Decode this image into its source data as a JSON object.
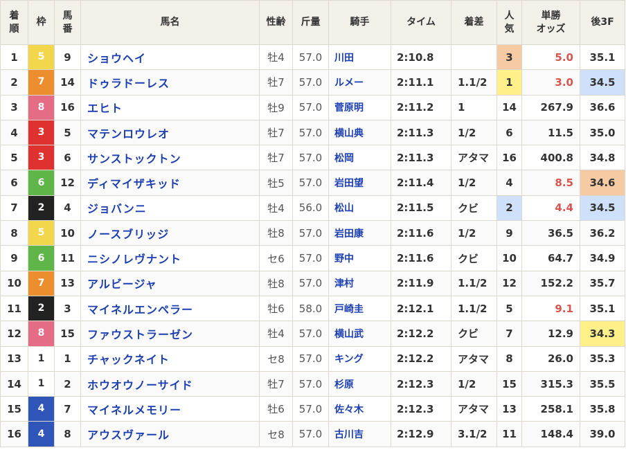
{
  "headers": {
    "pos": "着順",
    "gate": "枠",
    "num": "馬番",
    "name": "馬名",
    "sexage": "性齢",
    "weight": "斤量",
    "jockey": "騎手",
    "time": "タイム",
    "margin": "着差",
    "pop": "人気",
    "odds": "単勝オッズ",
    "last3f": "後3F"
  },
  "header_lines": {
    "pos": [
      "着",
      "順"
    ],
    "num": [
      "馬",
      "番"
    ],
    "pop": [
      "人",
      "気"
    ],
    "odds": [
      "単勝",
      "オッズ"
    ]
  },
  "gate_colors": {
    "1": {
      "bg": "#ffffff",
      "fg": "#333333"
    },
    "2": {
      "bg": "#222222",
      "fg": "#ffffff"
    },
    "3": {
      "bg": "#e03131",
      "fg": "#ffffff"
    },
    "4": {
      "bg": "#2f55b8",
      "fg": "#ffffff"
    },
    "5": {
      "bg": "#f2d64b",
      "fg": "#ffffff"
    },
    "6": {
      "bg": "#5fb547",
      "fg": "#ffffff"
    },
    "7": {
      "bg": "#ec8e2e",
      "fg": "#ffffff"
    },
    "8": {
      "bg": "#e46c84",
      "fg": "#ffffff"
    }
  },
  "rows": [
    {
      "pos": "1",
      "gate": "5",
      "num": "9",
      "name": "ショウヘイ",
      "sexage": "牡4",
      "weight": "57.0",
      "jockey": "川田",
      "time": "2:10.8",
      "margin": "",
      "pop": "3",
      "odds": "5.0",
      "last3f": "35.1",
      "fav": true,
      "pop_hl": "orange",
      "l3f_hl": ""
    },
    {
      "pos": "2",
      "gate": "7",
      "num": "14",
      "name": "ドゥラドーレス",
      "sexage": "牡7",
      "weight": "57.0",
      "jockey": "ルメー",
      "time": "2:11.1",
      "margin": "1.1/2",
      "pop": "1",
      "odds": "3.0",
      "last3f": "34.5",
      "fav": true,
      "pop_hl": "yellow",
      "l3f_hl": "blue"
    },
    {
      "pos": "3",
      "gate": "8",
      "num": "16",
      "name": "エヒト",
      "sexage": "牡9",
      "weight": "57.0",
      "jockey": "菅原明",
      "time": "2:11.2",
      "margin": "1",
      "pop": "14",
      "odds": "267.9",
      "last3f": "36.6",
      "fav": false,
      "pop_hl": "",
      "l3f_hl": ""
    },
    {
      "pos": "4",
      "gate": "3",
      "num": "5",
      "name": "マテンロウレオ",
      "sexage": "牡7",
      "weight": "57.0",
      "jockey": "横山典",
      "time": "2:11.3",
      "margin": "1/2",
      "pop": "6",
      "odds": "11.5",
      "last3f": "35.0",
      "fav": false,
      "pop_hl": "",
      "l3f_hl": ""
    },
    {
      "pos": "5",
      "gate": "3",
      "num": "6",
      "name": "サンストックトン",
      "sexage": "牡7",
      "weight": "57.0",
      "jockey": "松岡",
      "time": "2:11.3",
      "margin": "アタマ",
      "pop": "16",
      "odds": "400.8",
      "last3f": "34.8",
      "fav": false,
      "pop_hl": "",
      "l3f_hl": ""
    },
    {
      "pos": "6",
      "gate": "6",
      "num": "12",
      "name": "ディマイザキッド",
      "sexage": "牡5",
      "weight": "57.0",
      "jockey": "岩田望",
      "time": "2:11.4",
      "margin": "1/2",
      "pop": "4",
      "odds": "8.5",
      "last3f": "34.6",
      "fav": true,
      "pop_hl": "",
      "l3f_hl": "orange"
    },
    {
      "pos": "7",
      "gate": "2",
      "num": "4",
      "name": "ジョバンニ",
      "sexage": "牡4",
      "weight": "56.0",
      "jockey": "松山",
      "time": "2:11.5",
      "margin": "クビ",
      "pop": "2",
      "odds": "4.4",
      "last3f": "34.5",
      "fav": true,
      "pop_hl": "blue",
      "l3f_hl": "blue"
    },
    {
      "pos": "8",
      "gate": "5",
      "num": "10",
      "name": "ノースブリッジ",
      "sexage": "牡8",
      "weight": "57.0",
      "jockey": "岩田康",
      "time": "2:11.6",
      "margin": "1/2",
      "pop": "9",
      "odds": "36.5",
      "last3f": "36.2",
      "fav": false,
      "pop_hl": "",
      "l3f_hl": ""
    },
    {
      "pos": "9",
      "gate": "6",
      "num": "11",
      "name": "ニシノレヴナント",
      "sexage": "セ6",
      "weight": "57.0",
      "jockey": "野中",
      "time": "2:11.6",
      "margin": "クビ",
      "pop": "10",
      "odds": "64.7",
      "last3f": "34.9",
      "fav": false,
      "pop_hl": "",
      "l3f_hl": ""
    },
    {
      "pos": "10",
      "gate": "7",
      "num": "13",
      "name": "アルビージャ",
      "sexage": "牡8",
      "weight": "57.0",
      "jockey": "津村",
      "time": "2:11.9",
      "margin": "1.1/2",
      "pop": "12",
      "odds": "152.2",
      "last3f": "35.7",
      "fav": false,
      "pop_hl": "",
      "l3f_hl": ""
    },
    {
      "pos": "11",
      "gate": "2",
      "num": "3",
      "name": "マイネルエンペラー",
      "sexage": "牡6",
      "weight": "58.0",
      "jockey": "戸崎圭",
      "time": "2:12.1",
      "margin": "1.1/2",
      "pop": "5",
      "odds": "9.1",
      "last3f": "35.1",
      "fav": true,
      "pop_hl": "",
      "l3f_hl": ""
    },
    {
      "pos": "12",
      "gate": "8",
      "num": "15",
      "name": "ファウストラーゼン",
      "sexage": "牡4",
      "weight": "57.0",
      "jockey": "横山武",
      "time": "2:12.2",
      "margin": "クビ",
      "pop": "7",
      "odds": "12.9",
      "last3f": "34.3",
      "fav": false,
      "pop_hl": "",
      "l3f_hl": "yellow"
    },
    {
      "pos": "13",
      "gate": "1",
      "num": "1",
      "name": "チャックネイト",
      "sexage": "セ8",
      "weight": "57.0",
      "jockey": "キング",
      "time": "2:12.2",
      "margin": "アタマ",
      "pop": "8",
      "odds": "26.0",
      "last3f": "35.3",
      "fav": false,
      "pop_hl": "",
      "l3f_hl": ""
    },
    {
      "pos": "14",
      "gate": "1",
      "num": "2",
      "name": "ホウオウノーサイド",
      "sexage": "牡7",
      "weight": "57.0",
      "jockey": "杉原",
      "time": "2:12.3",
      "margin": "1/2",
      "pop": "15",
      "odds": "315.3",
      "last3f": "35.5",
      "fav": false,
      "pop_hl": "",
      "l3f_hl": ""
    },
    {
      "pos": "15",
      "gate": "4",
      "num": "7",
      "name": "マイネルメモリー",
      "sexage": "牡6",
      "weight": "57.0",
      "jockey": "佐々木",
      "time": "2:12.3",
      "margin": "アタマ",
      "pop": "13",
      "odds": "258.1",
      "last3f": "35.8",
      "fav": false,
      "pop_hl": "",
      "l3f_hl": ""
    },
    {
      "pos": "16",
      "gate": "4",
      "num": "8",
      "name": "アウスヴァール",
      "sexage": "セ8",
      "weight": "57.0",
      "jockey": "古川吉",
      "time": "2:12.9",
      "margin": "3.1/2",
      "pop": "11",
      "odds": "148.4",
      "last3f": "39.0",
      "fav": false,
      "pop_hl": "",
      "l3f_hl": ""
    }
  ]
}
